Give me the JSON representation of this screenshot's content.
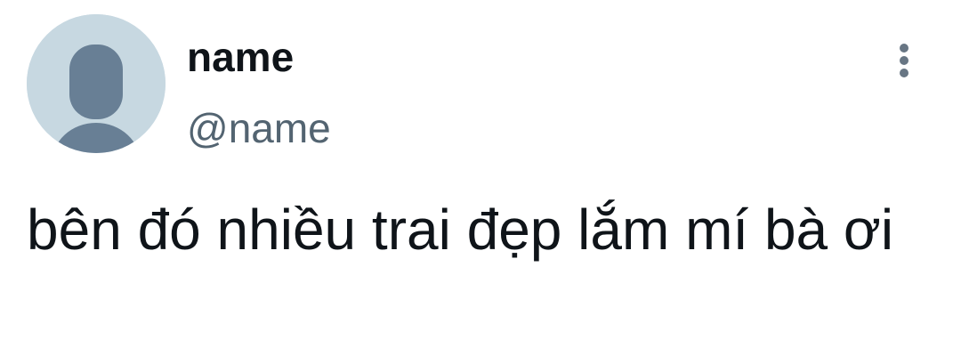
{
  "author": {
    "display_name": "name",
    "handle": "@name",
    "avatar_icon": "default-profile-icon",
    "avatar_bg": "#c7d8e1",
    "avatar_fg": "#687f95"
  },
  "menu": {
    "icon": "more-vertical-icon",
    "color": "#687684"
  },
  "tweet": {
    "text": "bên đó nhiều trai đẹp lắm mí bà ơi"
  }
}
